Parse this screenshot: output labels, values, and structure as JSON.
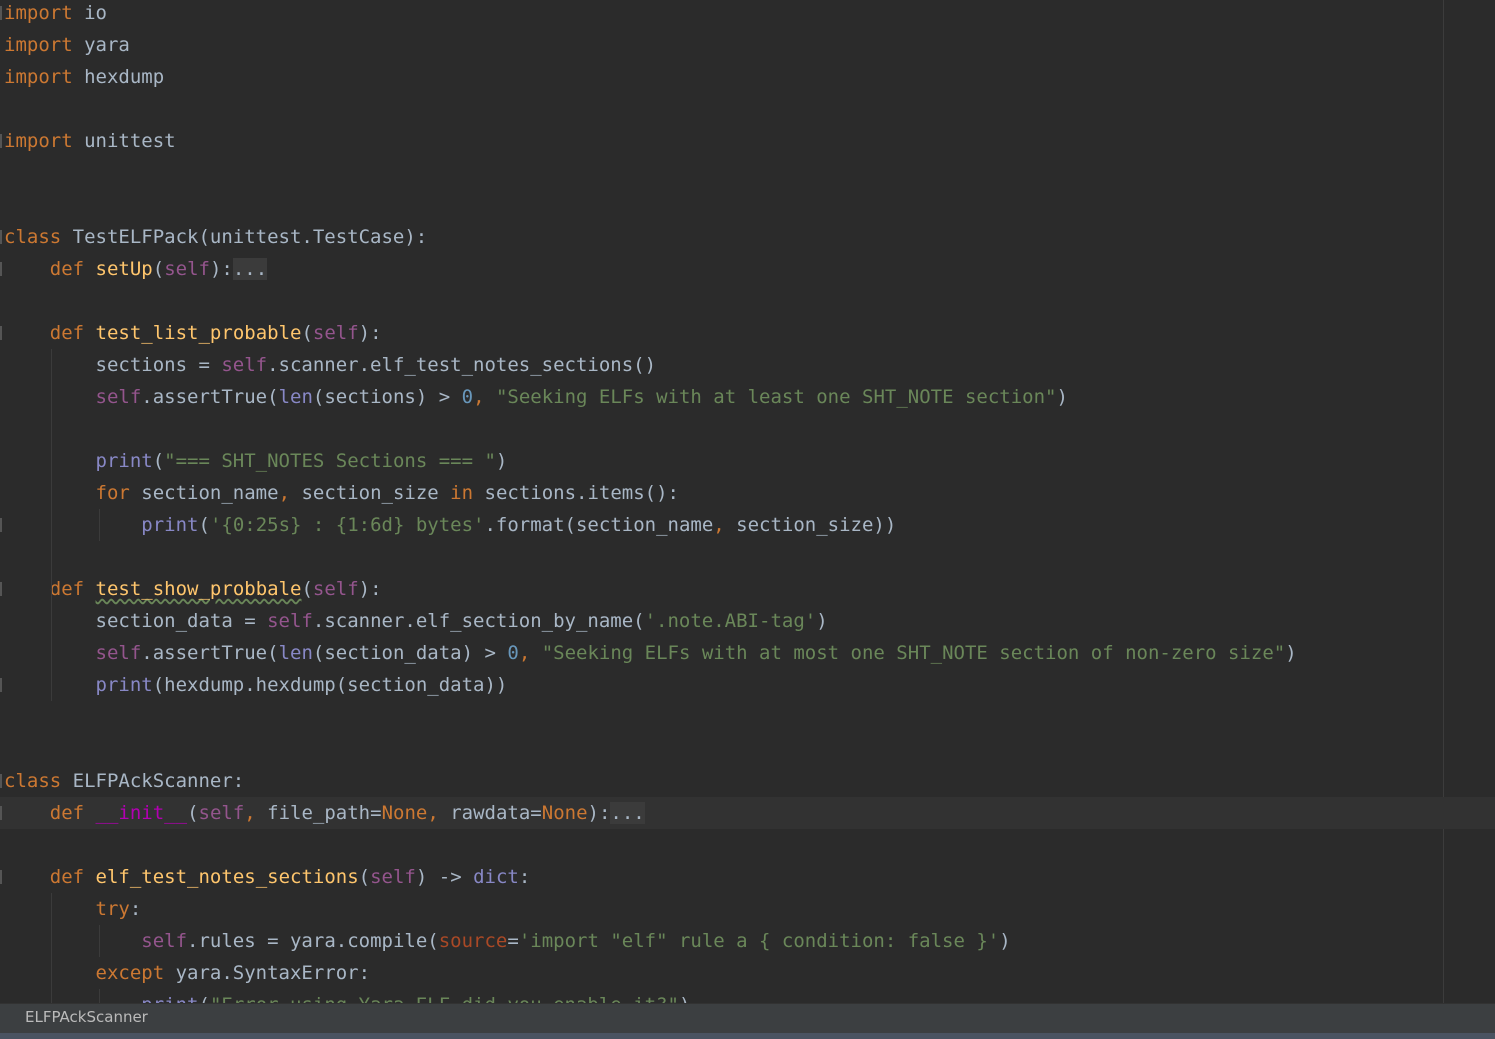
{
  "lines": [
    [
      [
        "kw",
        "import"
      ],
      [
        "pl",
        " io"
      ]
    ],
    [
      [
        "kw",
        "import"
      ],
      [
        "pl",
        " yara"
      ]
    ],
    [
      [
        "kw",
        "import"
      ],
      [
        "pl",
        " hexdump"
      ]
    ],
    [],
    [
      [
        "kw",
        "import"
      ],
      [
        "pl",
        " unittest"
      ]
    ],
    [],
    [],
    [
      [
        "kw",
        "class"
      ],
      [
        "pl",
        " TestELFPack(unittest.TestCase):"
      ]
    ],
    [
      [
        "pl",
        "    "
      ],
      [
        "kw",
        "def"
      ],
      [
        "pl",
        " "
      ],
      [
        "fn",
        "setUp"
      ],
      [
        "pl",
        "("
      ],
      [
        "self",
        "self"
      ],
      [
        "pl",
        "):"
      ],
      [
        "fold",
        "..."
      ]
    ],
    [],
    [
      [
        "pl",
        "    "
      ],
      [
        "kw",
        "def"
      ],
      [
        "pl",
        " "
      ],
      [
        "fn",
        "test_list_probable"
      ],
      [
        "pl",
        "("
      ],
      [
        "self",
        "self"
      ],
      [
        "pl",
        "):"
      ]
    ],
    [
      [
        "pl",
        "        sections = "
      ],
      [
        "self",
        "self"
      ],
      [
        "pl",
        ".scanner.elf_test_notes_sections()"
      ]
    ],
    [
      [
        "pl",
        "        "
      ],
      [
        "self",
        "self"
      ],
      [
        "pl",
        ".assertTrue("
      ],
      [
        "builtin",
        "len"
      ],
      [
        "pl",
        "(sections) > "
      ],
      [
        "num",
        "0"
      ],
      [
        "kw",
        ", "
      ],
      [
        "str",
        "\"Seeking ELFs with at least one SHT_NOTE section\""
      ],
      [
        "pl",
        ")"
      ]
    ],
    [],
    [
      [
        "pl",
        "        "
      ],
      [
        "builtin",
        "print"
      ],
      [
        "pl",
        "("
      ],
      [
        "str",
        "\"=== SHT_NOTES Sections === \""
      ],
      [
        "pl",
        ")"
      ]
    ],
    [
      [
        "pl",
        "        "
      ],
      [
        "kw",
        "for"
      ],
      [
        "pl",
        " section_name"
      ],
      [
        "kw",
        ","
      ],
      [
        "pl",
        " section_size "
      ],
      [
        "kw",
        "in"
      ],
      [
        "pl",
        " sections.items():"
      ]
    ],
    [
      [
        "pl",
        "            "
      ],
      [
        "builtin",
        "print"
      ],
      [
        "pl",
        "("
      ],
      [
        "str",
        "'{0:25s} : {1:6d} bytes'"
      ],
      [
        "pl",
        ".format(section_name"
      ],
      [
        "kw",
        ","
      ],
      [
        "pl",
        " section_size))"
      ]
    ],
    [],
    [
      [
        "pl",
        "    "
      ],
      [
        "kw",
        "def"
      ],
      [
        "pl",
        " "
      ],
      [
        "fntypo",
        "test_show_probbale"
      ],
      [
        "pl",
        "("
      ],
      [
        "self",
        "self"
      ],
      [
        "pl",
        "):"
      ]
    ],
    [
      [
        "pl",
        "        section_data = "
      ],
      [
        "self",
        "self"
      ],
      [
        "pl",
        ".scanner.elf_section_by_name("
      ],
      [
        "str",
        "'.note.ABI-tag'"
      ],
      [
        "pl",
        ")"
      ]
    ],
    [
      [
        "pl",
        "        "
      ],
      [
        "self",
        "self"
      ],
      [
        "pl",
        ".assertTrue("
      ],
      [
        "builtin",
        "len"
      ],
      [
        "pl",
        "(section_data) > "
      ],
      [
        "num",
        "0"
      ],
      [
        "kw",
        ", "
      ],
      [
        "str",
        "\"Seeking ELFs with at most one SHT_NOTE section of non-zero size\""
      ],
      [
        "pl",
        ")"
      ]
    ],
    [
      [
        "pl",
        "        "
      ],
      [
        "builtin",
        "print"
      ],
      [
        "pl",
        "(hexdump.hexdump(section_data))"
      ]
    ],
    [],
    [],
    [
      [
        "kw",
        "class"
      ],
      [
        "pl",
        " ELFPAckScanner:"
      ]
    ],
    [
      [
        "pl",
        "    "
      ],
      [
        "kw",
        "def"
      ],
      [
        "pl",
        " "
      ],
      [
        "dunder",
        "__init__"
      ],
      [
        "pl",
        "("
      ],
      [
        "self",
        "self"
      ],
      [
        "kw",
        ","
      ],
      [
        "pl",
        " file_path="
      ],
      [
        "kw",
        "None"
      ],
      [
        "kw",
        ","
      ],
      [
        "pl",
        " rawdata="
      ],
      [
        "kw",
        "None"
      ],
      [
        "pl",
        "):"
      ],
      [
        "fold",
        "..."
      ]
    ],
    [],
    [
      [
        "pl",
        "    "
      ],
      [
        "kw",
        "def"
      ],
      [
        "pl",
        " "
      ],
      [
        "fn",
        "elf_test_notes_sections"
      ],
      [
        "pl",
        "("
      ],
      [
        "self",
        "self"
      ],
      [
        "pl",
        ") -> "
      ],
      [
        "builtin",
        "dict"
      ],
      [
        "pl",
        ":"
      ]
    ],
    [
      [
        "pl",
        "        "
      ],
      [
        "kw",
        "try"
      ],
      [
        "pl",
        ":"
      ]
    ],
    [
      [
        "pl",
        "            "
      ],
      [
        "self",
        "self"
      ],
      [
        "pl",
        ".rules = yara.compile("
      ],
      [
        "param",
        "source"
      ],
      [
        "pl",
        "="
      ],
      [
        "str",
        "'import \"elf\" rule a { condition: false }'"
      ],
      [
        "pl",
        ")"
      ]
    ],
    [
      [
        "pl",
        "        "
      ],
      [
        "kw",
        "except"
      ],
      [
        "pl",
        " yara.SyntaxError:"
      ]
    ],
    [
      [
        "pl",
        "            "
      ],
      [
        "builtin",
        "print"
      ],
      [
        "pl",
        "("
      ],
      [
        "str",
        "\"Error using Yara ELF did you enable it?\""
      ],
      [
        "pl",
        ")"
      ]
    ]
  ],
  "status": {
    "breadcrumb": "ELFPAckScanner"
  }
}
